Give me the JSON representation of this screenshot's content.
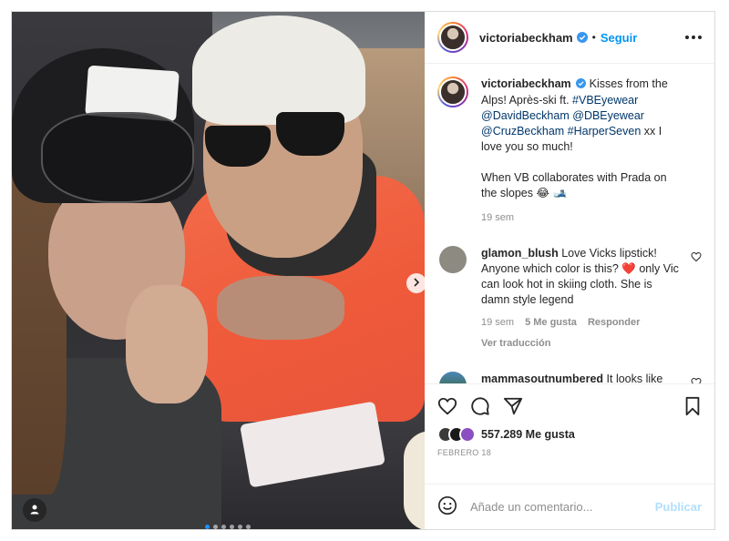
{
  "post": {
    "username": "victoriabeckham",
    "follow_label": "Seguir",
    "separator": "•"
  },
  "caption": {
    "username": "victoriabeckham",
    "text_1": "Kisses from the Alps! Après-ski ft. ",
    "tag_1": "#VBEyewear",
    "mention_1": "@DavidBeckham",
    "mention_2": "@DBEyewear",
    "mention_3": "@CruzBeckham",
    "tag_2": "#HarperSeven",
    "text_2": " xx I love you so much!",
    "text_3": "When VB collaborates with Prada on the slopes",
    "emoji": "😂 🎿",
    "time": "19 sem"
  },
  "comments": [
    {
      "username": "glamon_blush",
      "text_before": " Love Vicks lipstick! Anyone which color is this?",
      "heart": "❤️",
      "text_after": " only Vic can look hot in skiing cloth. She is damn style legend",
      "time": "19 sem",
      "likes": "5 Me gusta",
      "reply": "Responder",
      "translate": "Ver traducción",
      "avatar_color": "#8d8a82"
    },
    {
      "username": "mammasoutnumbered",
      "text": " It looks like David has a three fingered tiny hand 😂 not that there's anything",
      "avatar_color": "#3f6e5a"
    }
  ],
  "actions": {
    "likes_label": "557.289 Me gusta",
    "date": "Febrero 18"
  },
  "composer": {
    "placeholder": "Añade un comentario...",
    "publish_label": "Publicar"
  },
  "colors": {
    "accent": "#0095f6",
    "link": "#00376b",
    "muted": "#8e8e8e",
    "verified": "#3897f0"
  },
  "icons": {
    "verified": "verified-badge-icon",
    "more": "more-options-icon",
    "like": "heart-icon",
    "comment": "comment-icon",
    "share": "share-icon",
    "save": "bookmark-icon",
    "emoji": "emoji-icon",
    "next": "chevron-right-icon",
    "tag": "user-tag-icon"
  },
  "carousel": {
    "total_slides": 6,
    "active_slide": 1
  }
}
